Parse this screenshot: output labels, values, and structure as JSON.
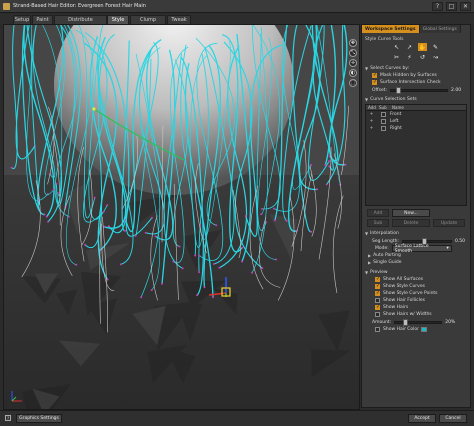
{
  "window": {
    "title": "Strand-Based Hair Editor: Evergreen Forest Hair Main",
    "controls": [
      "?",
      "□",
      "✕"
    ]
  },
  "tabs": [
    {
      "label": "Setup",
      "active": false
    },
    {
      "label": "Paint",
      "active": false
    },
    {
      "label": "Distribute",
      "active": false
    },
    {
      "label": "Style",
      "active": true
    },
    {
      "label": "Clump",
      "active": false
    },
    {
      "label": "Tweak",
      "active": false
    }
  ],
  "viewport": {
    "nav_tools": [
      {
        "name": "nav-select-icon",
        "glyph": "✥"
      },
      {
        "name": "nav-zoom-icon",
        "glyph": "⤡"
      },
      {
        "name": "nav-pan-icon",
        "glyph": "✛"
      },
      {
        "name": "nav-orbit-icon",
        "glyph": "◐"
      },
      {
        "name": "nav-frame-icon",
        "glyph": "⬚"
      }
    ],
    "colors": {
      "strands": "#29d6e3",
      "guide": "#29c45a",
      "point": "#c040b8",
      "head": "#d8d8d8"
    }
  },
  "panel": {
    "tabs": {
      "workspace": "Workspace Settings",
      "global": "Global Settings"
    },
    "style_curve_tools": "Style Curve Tools",
    "tools": [
      {
        "icon": "arrow-select-icon",
        "glyph": "↖",
        "active": false
      },
      {
        "icon": "arrow-move-icon",
        "glyph": "↗",
        "active": false
      },
      {
        "icon": "comb-icon",
        "glyph": "✋",
        "active": true
      },
      {
        "icon": "pen-icon",
        "glyph": "✎",
        "active": false
      },
      {
        "icon": "scissors-icon",
        "glyph": "✂",
        "active": false
      },
      {
        "icon": "wand-icon",
        "glyph": "⚡",
        "active": false
      },
      {
        "icon": "curl-icon",
        "glyph": "↺",
        "active": false
      },
      {
        "icon": "bend-icon",
        "glyph": "↝",
        "active": false
      }
    ],
    "select_curves_by": "Select Curves by:",
    "mask_hidden": "Mask Hidden by Surfaces",
    "surface_intersection": "Surface Intersection Check",
    "offset": {
      "label": "Offset:",
      "value": "2.00",
      "fraction": 0.1
    },
    "curve_selection_sets": "Curve Selection Sets",
    "table_headers": [
      "Add",
      "Sub",
      "Name"
    ],
    "sets": [
      {
        "name": "Front",
        "add": true
      },
      {
        "name": "Left",
        "add": false
      },
      {
        "name": "Right",
        "add": false
      }
    ],
    "buttons": {
      "add": "Add",
      "new": "New...",
      "sub": "Sub",
      "delete": "Delete",
      "update": "Update"
    },
    "interpolation": "Interpolation",
    "seg_length": {
      "label": "Seg Length:",
      "value": "0.50",
      "fraction": 0.45
    },
    "mode": {
      "label": "Mode:",
      "value": "Surface Lattice Smooth"
    },
    "auto_parting": "Auto Parting",
    "single_guide": "Single Guide",
    "preview": "Preview",
    "show_all_surfaces": "Show All Surfaces",
    "show_style_curves": "Show Style Curves",
    "show_style_curve_points": "Show Style Curve Points",
    "show_hair_follicles": "Show Hair Follicles",
    "show_hairs": "Show Hairs",
    "show_hairs_widths": "Show Hairs w/ Widths",
    "amount": {
      "label": "Amount:",
      "value": "20%",
      "fraction": 0.2
    },
    "show_hair_color": "Show Hair Color"
  },
  "footer": {
    "help": "?",
    "graphics_settings": "Graphics Settings",
    "accept": "Accept",
    "cancel": "Cancel"
  }
}
